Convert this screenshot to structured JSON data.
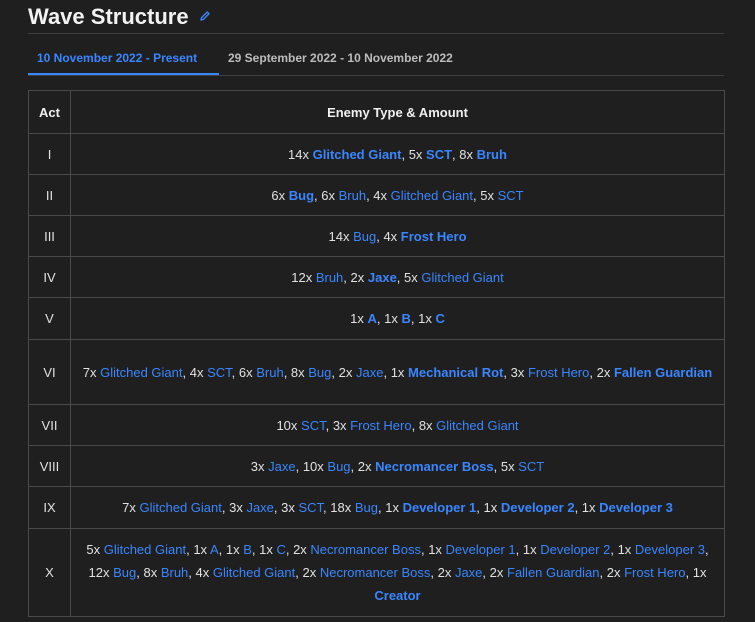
{
  "heading": {
    "title": "Wave Structure",
    "edit_icon": "pencil-icon"
  },
  "tabs": [
    {
      "label": "10 November 2022 - Present",
      "active": true
    },
    {
      "label": "29 September 2022 - 10 November 2022",
      "active": false
    }
  ],
  "table": {
    "headers": [
      "Act",
      "Enemy Type & Amount"
    ],
    "rows": [
      {
        "act": "I",
        "enemies": [
          {
            "count": "14x",
            "name": "Glitched Giant",
            "bold": true
          },
          {
            "count": "5x",
            "name": "SCT",
            "bold": true
          },
          {
            "count": "8x",
            "name": "Bruh",
            "bold": true
          }
        ]
      },
      {
        "act": "II",
        "enemies": [
          {
            "count": "6x",
            "name": "Bug",
            "bold": true
          },
          {
            "count": "6x",
            "name": "Bruh",
            "bold": false
          },
          {
            "count": "4x",
            "name": "Glitched Giant",
            "bold": false
          },
          {
            "count": "5x",
            "name": "SCT",
            "bold": false
          }
        ]
      },
      {
        "act": "III",
        "enemies": [
          {
            "count": "14x",
            "name": "Bug",
            "bold": false
          },
          {
            "count": "4x",
            "name": "Frost Hero",
            "bold": true
          }
        ]
      },
      {
        "act": "IV",
        "enemies": [
          {
            "count": "12x",
            "name": "Bruh",
            "bold": false
          },
          {
            "count": "2x",
            "name": "Jaxe",
            "bold": true
          },
          {
            "count": "5x",
            "name": "Glitched Giant",
            "bold": false
          }
        ]
      },
      {
        "act": "V",
        "enemies": [
          {
            "count": "1x",
            "name": "A",
            "bold": true
          },
          {
            "count": "1x",
            "name": "B",
            "bold": true
          },
          {
            "count": "1x",
            "name": "C",
            "bold": true
          }
        ]
      },
      {
        "act": "VI",
        "enemies": [
          {
            "count": "7x",
            "name": "Glitched Giant",
            "bold": false
          },
          {
            "count": "4x",
            "name": "SCT",
            "bold": false
          },
          {
            "count": "6x",
            "name": "Bruh",
            "bold": false
          },
          {
            "count": "8x",
            "name": "Bug",
            "bold": false
          },
          {
            "count": "2x",
            "name": "Jaxe",
            "bold": false
          },
          {
            "count": "1x",
            "name": "Mechanical Rot",
            "bold": true
          },
          {
            "count": "3x",
            "name": "Frost Hero",
            "bold": false
          },
          {
            "count": "2x",
            "name": "Fallen Guardian",
            "bold": true
          }
        ]
      },
      {
        "act": "VII",
        "enemies": [
          {
            "count": "10x",
            "name": "SCT",
            "bold": false
          },
          {
            "count": "3x",
            "name": "Frost Hero",
            "bold": false
          },
          {
            "count": "8x",
            "name": "Glitched Giant",
            "bold": false
          }
        ]
      },
      {
        "act": "VIII",
        "enemies": [
          {
            "count": "3x",
            "name": "Jaxe",
            "bold": false
          },
          {
            "count": "10x",
            "name": "Bug",
            "bold": false
          },
          {
            "count": "2x",
            "name": "Necromancer Boss",
            "bold": true
          },
          {
            "count": "5x",
            "name": "SCT",
            "bold": false
          }
        ]
      },
      {
        "act": "IX",
        "enemies": [
          {
            "count": "7x",
            "name": "Glitched Giant",
            "bold": false
          },
          {
            "count": "3x",
            "name": "Jaxe",
            "bold": false
          },
          {
            "count": "3x",
            "name": "SCT",
            "bold": false
          },
          {
            "count": "18x",
            "name": "Bug",
            "bold": false
          },
          {
            "count": "1x",
            "name": "Developer 1",
            "bold": true
          },
          {
            "count": "1x",
            "name": "Developer 2",
            "bold": true
          },
          {
            "count": "1x",
            "name": "Developer 3",
            "bold": true
          }
        ]
      },
      {
        "act": "X",
        "enemies": [
          {
            "count": "5x",
            "name": "Glitched Giant",
            "bold": false
          },
          {
            "count": "1x",
            "name": "A",
            "bold": false
          },
          {
            "count": "1x",
            "name": "B",
            "bold": false
          },
          {
            "count": "1x",
            "name": "C",
            "bold": false
          },
          {
            "count": "2x",
            "name": "Necromancer Boss",
            "bold": false
          },
          {
            "count": "1x",
            "name": "Developer 1",
            "bold": false
          },
          {
            "count": "1x",
            "name": "Developer 2",
            "bold": false
          },
          {
            "count": "1x",
            "name": "Developer 3",
            "bold": false
          },
          {
            "count": "12x",
            "name": "Bug",
            "bold": false
          },
          {
            "count": "8x",
            "name": "Bruh",
            "bold": false
          },
          {
            "count": "4x",
            "name": "Glitched Giant",
            "bold": false
          },
          {
            "count": "2x",
            "name": "Necromancer Boss",
            "bold": false
          },
          {
            "count": "2x",
            "name": "Jaxe",
            "bold": false
          },
          {
            "count": "2x",
            "name": "Fallen Guardian",
            "bold": false
          },
          {
            "count": "2x",
            "name": "Frost Hero",
            "bold": false
          },
          {
            "count": "1x",
            "name": "Creator",
            "bold": true
          }
        ]
      }
    ]
  },
  "colors": {
    "link": "#3a86ff",
    "background": "#1f1f1f",
    "border": "#4a4a4a"
  }
}
